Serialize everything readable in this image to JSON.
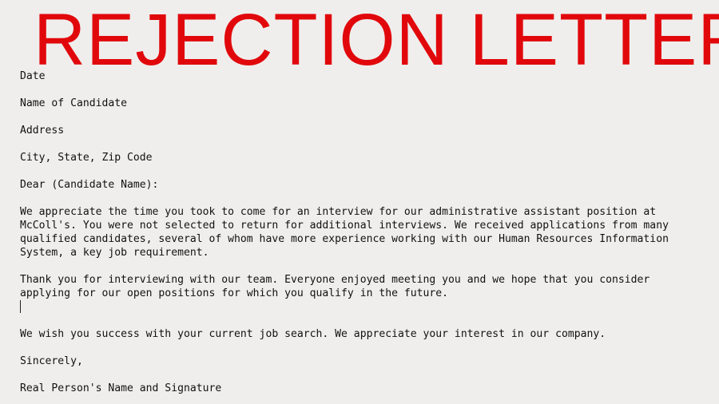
{
  "title": "REJECTION LETTER",
  "colors": {
    "title": "#e1080c",
    "background": "#efeeec",
    "text": "#111111"
  },
  "letter": {
    "date": "Date",
    "candidate_name": "Name of Candidate",
    "address": "Address",
    "city_state_zip": "City, State, Zip Code",
    "salutation": "Dear (Candidate Name):",
    "paragraph1": [
      "We appreciate the time you took to come for an interview for our administrative assistant position at",
      "McColl's. You were not selected to return for additional interviews. We received applications from many",
      "qualified candidates, several of whom have more experience working with our Human Resources Information",
      "System, a key job requirement."
    ],
    "paragraph2": [
      "Thank you for interviewing with our team. Everyone enjoyed meeting you and we hope that you consider",
      "applying for our open positions for which you qualify in the future."
    ],
    "paragraph3": "We wish you success with your current job search. We appreciate your interest in our company.",
    "closing": "Sincerely,",
    "signature": "Real Person's Name and Signature"
  }
}
